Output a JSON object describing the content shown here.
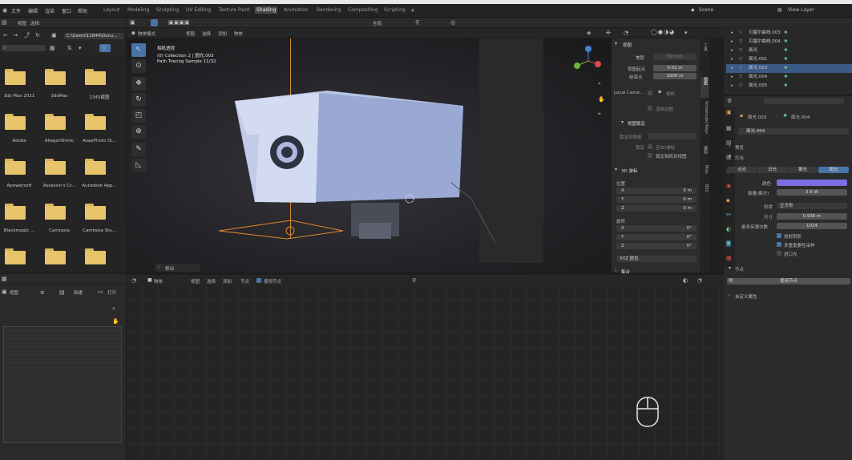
{
  "menu": [
    "文件",
    "编辑",
    "渲染",
    "窗口",
    "帮助"
  ],
  "workspaces": [
    "Layout",
    "Modeling",
    "Sculpting",
    "UV Editing",
    "Texture Paint",
    "Shading",
    "Animation",
    "Rendering",
    "Compositing",
    "Scripting"
  ],
  "active_workspace": "Shading",
  "scene": {
    "name": "Scene",
    "view_layer": "View Layer"
  },
  "file_browser": {
    "menu": [
      "视图",
      "选择"
    ],
    "path": "C:\\Users\\11844\\Docu...",
    "items": [
      "3ds Max 2021",
      "3dsMax",
      "2345截图",
      "Adobe",
      "Allegorithmic",
      "AoaoPhoto Di...",
      "Apowersoft",
      "Assassin's Cr...",
      "Autodesk App...",
      "Blackmagic ...",
      "Camtasia",
      "Camtasia Stu...",
      "",
      "",
      ""
    ]
  },
  "image_editor": {
    "view_label": "视图",
    "new_label": "新建",
    "open_label": "打开"
  },
  "viewport": {
    "mode": "物体模式",
    "menu": [
      "视图",
      "选择",
      "添加",
      "物体"
    ],
    "transform": "全局",
    "overlay_lines": [
      "相机透视",
      "(0) Collection 2 | 圆光.003",
      "Path Tracing Sample 11/32"
    ],
    "operator_panel": "移动"
  },
  "view_panel": {
    "title": "视图",
    "focal_label": "焦距",
    "focal_value": "50 mm",
    "clip_start_label": "视图起点",
    "clip_start_value": "0.01 m",
    "clip_end_label": "结束点",
    "clip_end_value": "1000 m",
    "local_camera_label": "Local Came...",
    "camera_label": "相机",
    "render_region_label": "渲染边框",
    "view_lock_title": "视图锁定",
    "lock_object_label": "锁定到物体",
    "lock_label": "锁定",
    "to_3d_cursor_label": "至3D游标",
    "lock_camera_label": "锁定相机到视图"
  },
  "cursor_panel": {
    "title": "3D 游标",
    "location_label": "位置",
    "loc": [
      {
        "axis": "X",
        "value": "0 m"
      },
      {
        "axis": "Y",
        "value": "0 m"
      },
      {
        "axis": "Z",
        "value": "0 m"
      }
    ],
    "rotation_label": "旋转",
    "rot": [
      {
        "axis": "X",
        "value": "0°"
      },
      {
        "axis": "Y",
        "value": "0°"
      },
      {
        "axis": "Z",
        "value": "0°"
      }
    ],
    "rotation_mode": "XYZ 欧拉",
    "collections_label": "集合"
  },
  "sidebar_tabs": [
    "工具",
    "视图",
    "Screencast Keys",
    "编辑",
    "Misc",
    "BSS"
  ],
  "node_editor": {
    "mode": "物体",
    "menu": [
      "视图",
      "选择",
      "添加",
      "节点"
    ],
    "use_nodes": "使用节点"
  },
  "outliner": {
    "items": [
      {
        "label": "贝塞尔曲线.003",
        "selected": false
      },
      {
        "label": "贝塞尔曲线.004",
        "selected": false
      },
      {
        "label": "面光",
        "selected": false
      },
      {
        "label": "面光.001",
        "selected": false
      },
      {
        "label": "面光.003",
        "selected": true
      },
      {
        "label": "面光.004",
        "selected": false
      },
      {
        "label": "面光.005",
        "selected": false
      }
    ]
  },
  "properties": {
    "breadcrumb": [
      "面光.003",
      "面光.004"
    ],
    "data_name": "面光.004",
    "preview_label": "预览",
    "light_label": "灯光",
    "light_types": [
      "点光",
      "日光",
      "聚光",
      "面光"
    ],
    "active_light_type": "面光",
    "color_label": "颜色",
    "color_value": "#7b6ee0",
    "power_label": "能量(乘方)",
    "power_value": "3.6 W",
    "shape_label": "形状",
    "shape_value": "正方形",
    "size_label": "尺寸",
    "size_value": "0.936 m",
    "max_bounces_label": "最多反弹次数",
    "max_bounces_value": "1024",
    "cast_shadow_label": "投射阴影",
    "mis_label": "多重重要性采样",
    "portal_label": "进口光",
    "nodes_label": "节点",
    "use_nodes_label": "使用节点",
    "custom_props_label": "自定义属性"
  }
}
